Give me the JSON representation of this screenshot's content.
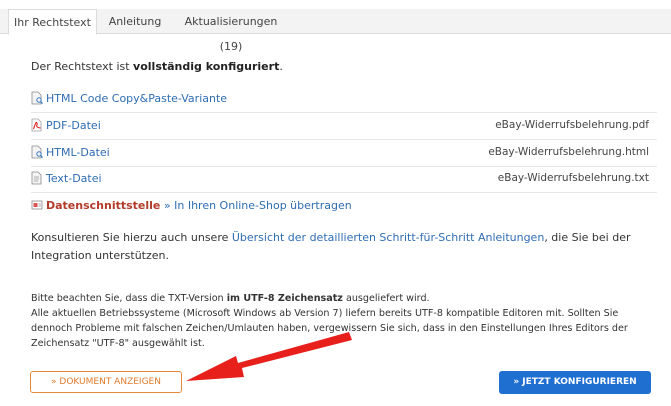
{
  "tabs": [
    {
      "label": "Ihr Rechtstext"
    },
    {
      "label": "Anleitung"
    },
    {
      "label": "Aktualisierungen (19)"
    }
  ],
  "status": {
    "prefix": "Der Rechtstext ist ",
    "bold": "vollständig konfiguriert",
    "suffix": "."
  },
  "rows": [
    {
      "link": "HTML Code Copy&Paste-Variante",
      "file": "",
      "icon": "document-search-icon"
    },
    {
      "link": "PDF-Datei",
      "file": "eBay-Widerrufsbelehrung.pdf",
      "icon": "pdf-icon"
    },
    {
      "link": "HTML-Datei",
      "file": "eBay-Widerrufsbelehrung.html",
      "icon": "document-search-icon"
    },
    {
      "link": "Text-Datei",
      "file": "eBay-Widerrufsbelehrung.txt",
      "icon": "text-file-icon"
    }
  ],
  "interface": {
    "label": "Datenschnittstelle",
    "link": " » In Ihren Online-Shop übertragen"
  },
  "consult": {
    "prefix": "Konsultieren Sie hierzu auch unsere ",
    "link": "Übersicht der detaillierten Schritt-für-Schritt Anleitungen",
    "suffix": ", die Sie bei der Integration unterstützen."
  },
  "note": {
    "line1_prefix": "Bitte beachten Sie, dass die TXT-Version ",
    "line1_bold": "im UTF-8 Zeichensatz",
    "line1_suffix": " ausgeliefert wird.",
    "rest": "Alle aktuellen Betriebssysteme (Microsoft Windows ab Version 7) liefern bereits UTF-8 kompatible Editoren mit. Sollten Sie dennoch Probleme mit falschen Zeichen/Umlauten haben, vergewissern Sie sich, dass in den Einstellungen Ihres Editors der Zeichensatz \"UTF-8\" ausgewählt ist."
  },
  "buttons": {
    "document": "» DOKUMENT ANZEIGEN",
    "configure": "» JETZT KONFIGURIEREN"
  },
  "colors": {
    "link": "#2f6db3",
    "accent_orange": "#e07a2a",
    "primary_blue": "#1f6fd0",
    "arrow_red": "#e8201c"
  }
}
